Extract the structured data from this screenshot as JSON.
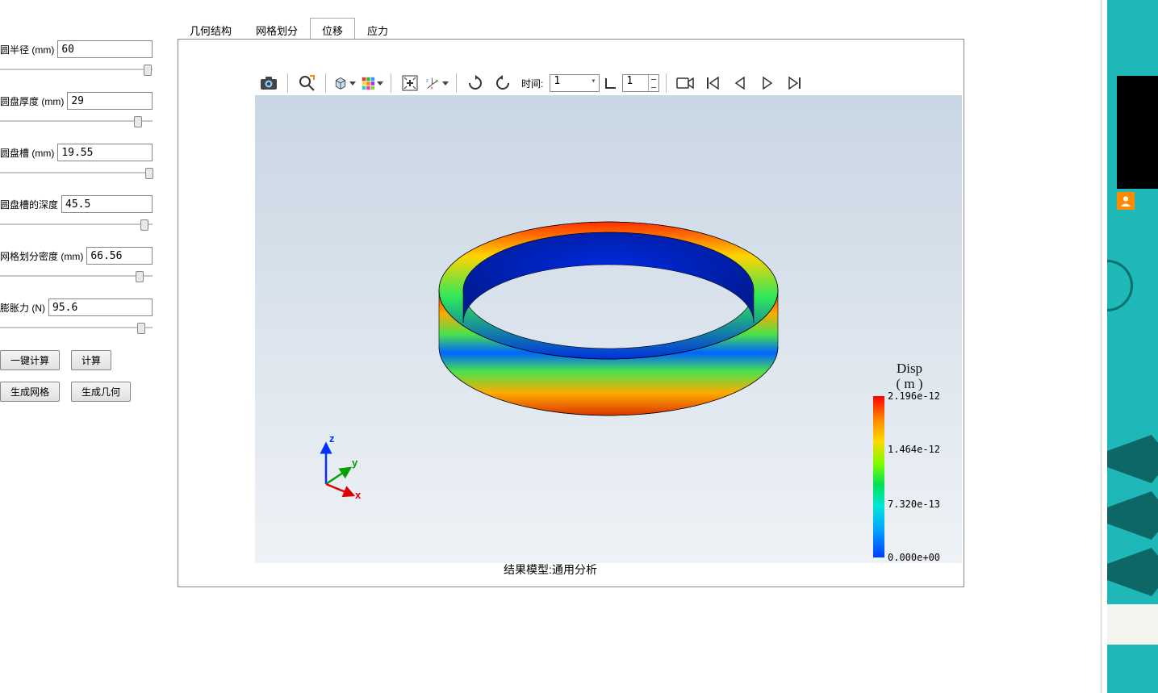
{
  "params": [
    {
      "label": "圆半径  (mm)",
      "value": "60",
      "thumb": 94
    },
    {
      "label": "圆盘厚度  (mm)",
      "value": "29",
      "thumb": 88
    },
    {
      "label": "圆盘槽  (mm)",
      "value": "19.55",
      "thumb": 95
    },
    {
      "label": "圆盘槽的深度",
      "value": "45.5",
      "thumb": 92
    },
    {
      "label": "网格划分密度  (mm)",
      "value": "66.56",
      "thumb": 89
    },
    {
      "label": "膨胀力  (N)",
      "value": "95.6",
      "thumb": 90
    }
  ],
  "buttons": {
    "onekey_calc": "一键计算",
    "calc": "计算",
    "gen_mesh": "生成网格",
    "gen_geom": "生成几何"
  },
  "tabs": [
    {
      "label": "几何结构",
      "active": false
    },
    {
      "label": "网格划分",
      "active": false
    },
    {
      "label": "位移",
      "active": true
    },
    {
      "label": "应力",
      "active": false
    }
  ],
  "toolbar": {
    "time_label": "时间:",
    "time_value": "1",
    "step_value": "1"
  },
  "legend": {
    "title1": "Disp",
    "title2": "( m )",
    "ticks": [
      {
        "pos": 0,
        "text": "2.196e-12"
      },
      {
        "pos": 33,
        "text": "1.464e-12"
      },
      {
        "pos": 67,
        "text": "7.320e-13"
      },
      {
        "pos": 100,
        "text": "0.000e+00"
      }
    ]
  },
  "result_caption": "结果模型:通用分析",
  "axes": {
    "x": "x",
    "y": "y",
    "z": "z"
  }
}
